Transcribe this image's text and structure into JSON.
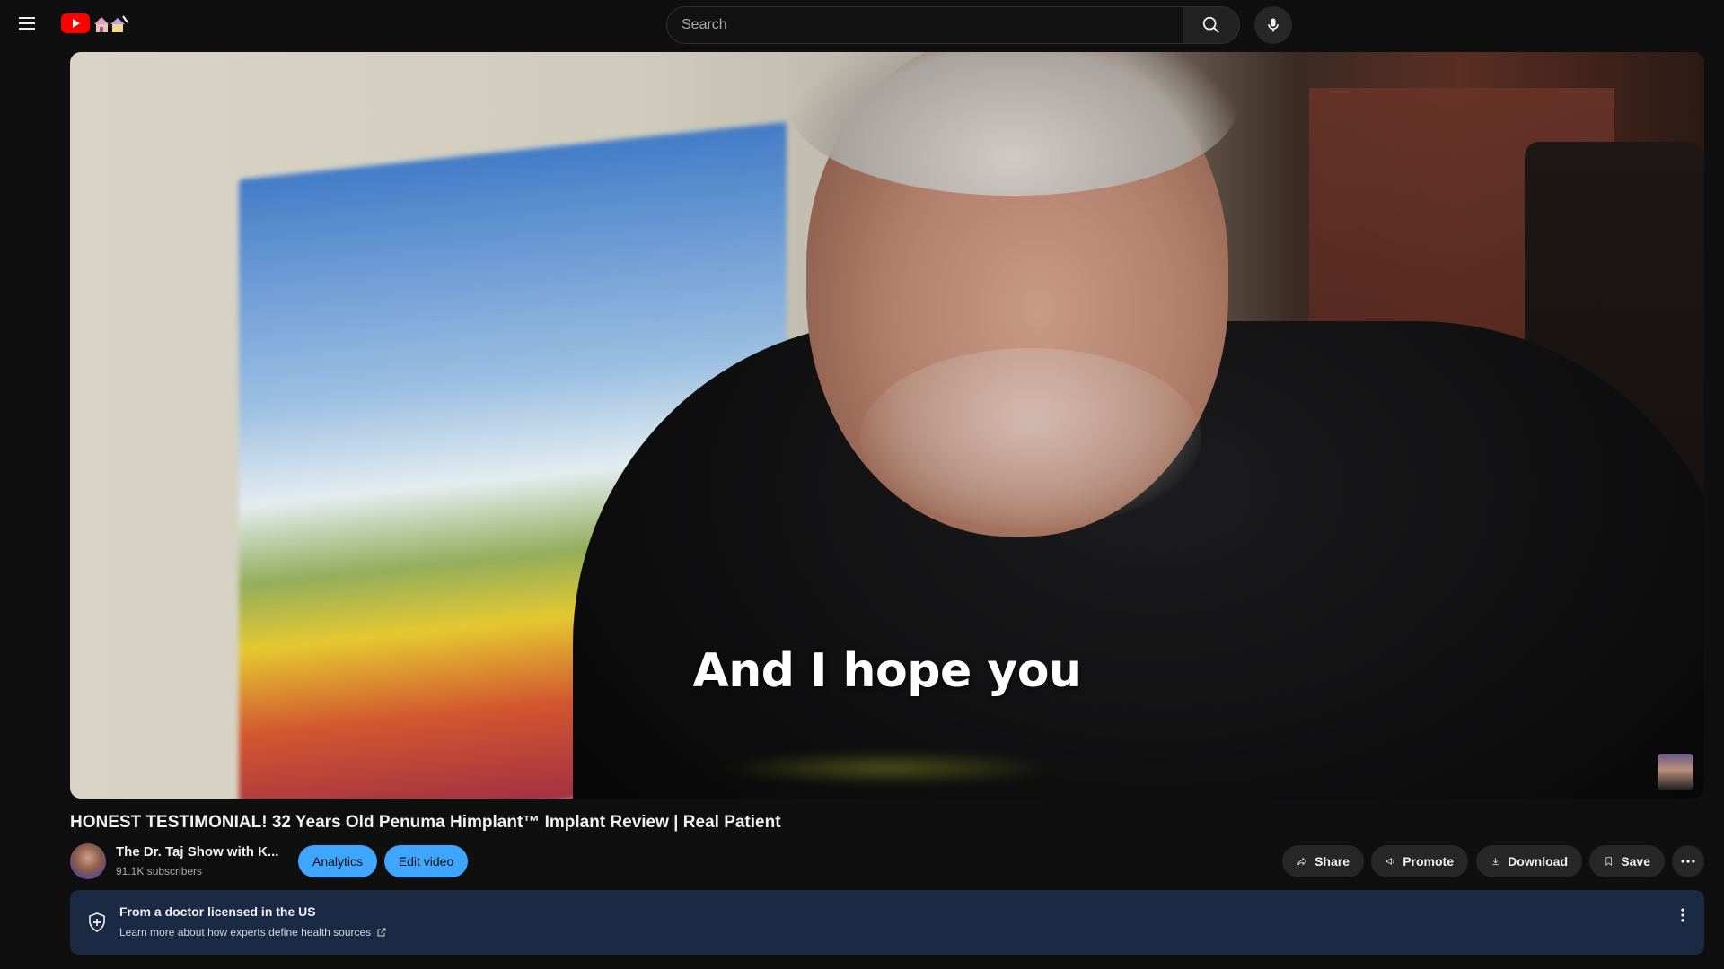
{
  "header": {
    "menu_icon": "hamburger-icon",
    "logo_icon": "youtube-logo-icon",
    "search": {
      "placeholder": "Search",
      "value": ""
    },
    "search_icon": "search-icon",
    "mic_icon": "microphone-icon"
  },
  "video": {
    "caption": "And I hope you"
  },
  "title": "HONEST TESTIMONIAL! 32 Years Old Penuma Himplant™ Implant Review | Real Patient",
  "channel": {
    "name": "The Dr. Taj Show with K...",
    "subscribers": "91.1K subscribers"
  },
  "owner_actions": {
    "analytics": "Analytics",
    "edit_video": "Edit video"
  },
  "actions": {
    "share": "Share",
    "promote": "Promote",
    "download": "Download",
    "save": "Save"
  },
  "health_panel": {
    "title": "From a doctor licensed in the US",
    "link": "Learn more about how experts define health sources"
  },
  "colors": {
    "background": "#0f0f0f",
    "accent_blue": "#3ea6ff",
    "youtube_red": "#ff0000",
    "health_panel_bg": "#1a2a45"
  }
}
